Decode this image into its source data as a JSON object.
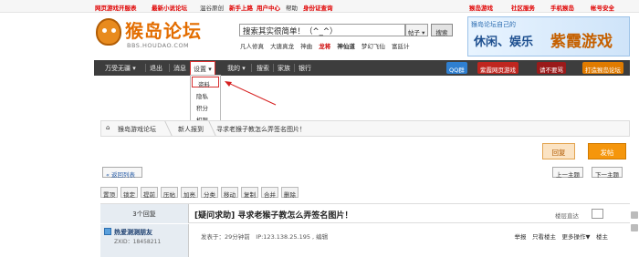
{
  "topbar": {
    "left": [
      "网页游戏开服表",
      "最新小说论坛",
      "温谷原创",
      "新手上路",
      "用户中心",
      "帮助",
      "身份证查询"
    ],
    "right": [
      "猴岛游戏",
      "社区服务",
      "手机猴岛",
      "帐号安全"
    ]
  },
  "logo": {
    "title": "猴岛论坛",
    "subtitle": "BBS.HOUDAO.COM"
  },
  "search": {
    "value": "搜索其实很简单！（^_^）",
    "scope": "帖子",
    "button": "搜索"
  },
  "hotwords": [
    "凡人修真",
    "大唐真龙",
    "神曲",
    "龙将",
    "神仙道",
    "梦幻飞仙",
    "富廷计"
  ],
  "banner": {
    "line1": "猴岛论坛自己的",
    "line2": "休闲、娱乐",
    "line3": "紫霞游戏"
  },
  "nav": {
    "items": [
      "万受无疆",
      "退出",
      "消息",
      "设置",
      "我的",
      "搜索",
      "家族",
      "银行"
    ],
    "right_buttons": [
      "QQ群",
      "紫霞网页游戏",
      "请不要骂",
      "打造猴岛论坛"
    ]
  },
  "dropdown": {
    "items": [
      "资料",
      "隐私",
      "积分",
      "权限"
    ]
  },
  "breadcrumb": {
    "items": [
      "猴岛游戏论坛",
      "新人报到",
      "寻求老猴子教怎么弄签名图片！"
    ]
  },
  "actions": {
    "reply": "回复",
    "post": "发帖"
  },
  "back": "« 返回列表",
  "pager": {
    "prev": "上一主题",
    "next": "下一主题"
  },
  "modbar": [
    "置顶",
    "锁定",
    "提前",
    "压帖",
    "加亮",
    "分类",
    "移动",
    "复制",
    "合并",
    "删除"
  ],
  "thread": {
    "reply_count": "3个回复",
    "title": "[疑问求助] 寻求老猴子教怎么弄签名图片！",
    "view_mode": "楼层直达"
  },
  "post": {
    "username": "热爱测测朋友",
    "uid": "ZXID：18458211",
    "meta": "发表于：29分钟前　IP:123.138.25.195 , 编辑",
    "right": "举报　只看楼主　更多操作▼　楼主"
  },
  "colors": {
    "accent_red": "#e00000",
    "nav_bg": "#3d3d3d",
    "post_orange": "#f5960c"
  }
}
